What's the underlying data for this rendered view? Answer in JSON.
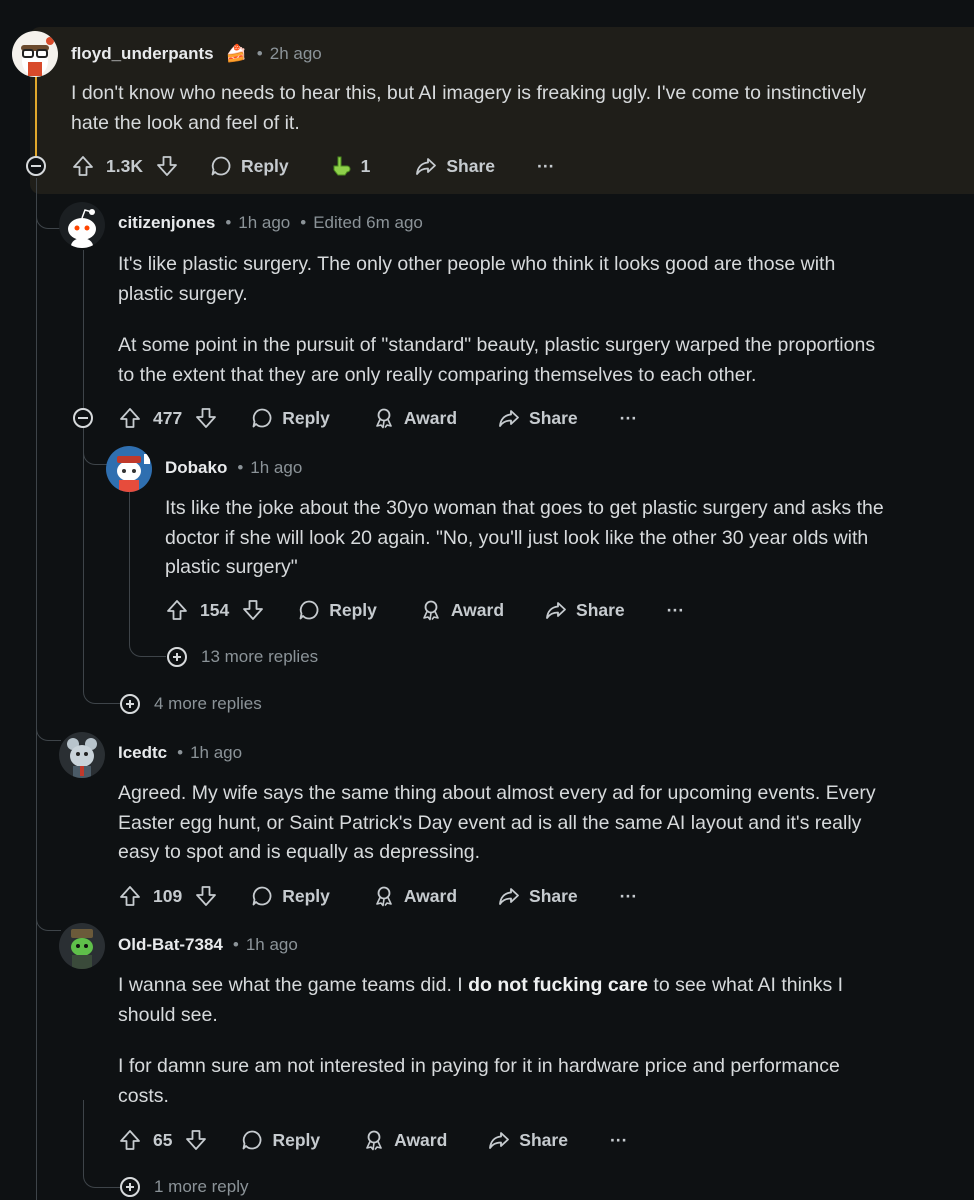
{
  "comments": [
    {
      "username": "floyd_underpants",
      "flair": "🍰",
      "time": "2h ago",
      "edited": "",
      "paragraphs": [
        "I don't know who needs to hear this, but AI imagery is freaking ugly. I've come to instinctively",
        "hate the look and feel of it."
      ],
      "votes": "1.3K",
      "reply_label": "Reply",
      "award_label": "1",
      "award_icon": "pointing-finger-award-icon",
      "share_label": "Share",
      "more_label": "···"
    },
    {
      "username": "citizenjones",
      "time": "1h ago",
      "edited": "Edited 6m ago",
      "paragraph1_lines": [
        "It's like plastic surgery. The only other people who think it looks good are those with",
        "plastic surgery."
      ],
      "paragraph2_lines": [
        "At some point in the pursuit of \"standard\" beauty, plastic surgery warped the proportions",
        "to the extent that they are only really comparing themselves to each other."
      ],
      "votes": "477",
      "reply_label": "Reply",
      "award_label": "Award",
      "share_label": "Share",
      "more_label": "···"
    },
    {
      "username": "Dobako",
      "time": "1h ago",
      "lines": [
        "Its like the joke about the 30yo woman that goes to get plastic surgery and asks the",
        "doctor if she will look 20 again. \"No, you'll just look like the other 30 year olds with",
        "plastic surgery\""
      ],
      "votes": "154",
      "reply_label": "Reply",
      "award_label": "Award",
      "share_label": "Share",
      "more_label": "···",
      "more_replies": "13 more replies"
    },
    {
      "more_replies": "4 more replies"
    },
    {
      "username": "Icedtc",
      "time": "1h ago",
      "lines": [
        "Agreed. My wife says the same thing about almost every ad for upcoming events. Every",
        "Easter egg hunt, or Saint Patrick's Day event ad is all the same AI layout and it's really",
        "easy to spot and is equally as depressing."
      ],
      "votes": "109",
      "reply_label": "Reply",
      "award_label": "Award",
      "share_label": "Share",
      "more_label": "···"
    },
    {
      "username": "Old-Bat-7384",
      "time": "1h ago",
      "p1_pre": "I wanna see what the game teams did. I ",
      "p1_bold": "do not fucking care",
      "p1_post": " to see what AI thinks I",
      "p1_line2": "should see.",
      "p2_lines": [
        "I for damn sure am not interested in paying for it in hardware price and performance",
        "costs."
      ],
      "votes": "65",
      "reply_label": "Reply",
      "award_label": "Award",
      "share_label": "Share",
      "more_label": "···",
      "more_replies": "1 more reply"
    }
  ],
  "colors": {
    "background": "#0e1113",
    "highlight": "#1f1e19",
    "thread_accent": "#e3a92c",
    "text": "#d7dadc",
    "muted": "#8b9398"
  }
}
